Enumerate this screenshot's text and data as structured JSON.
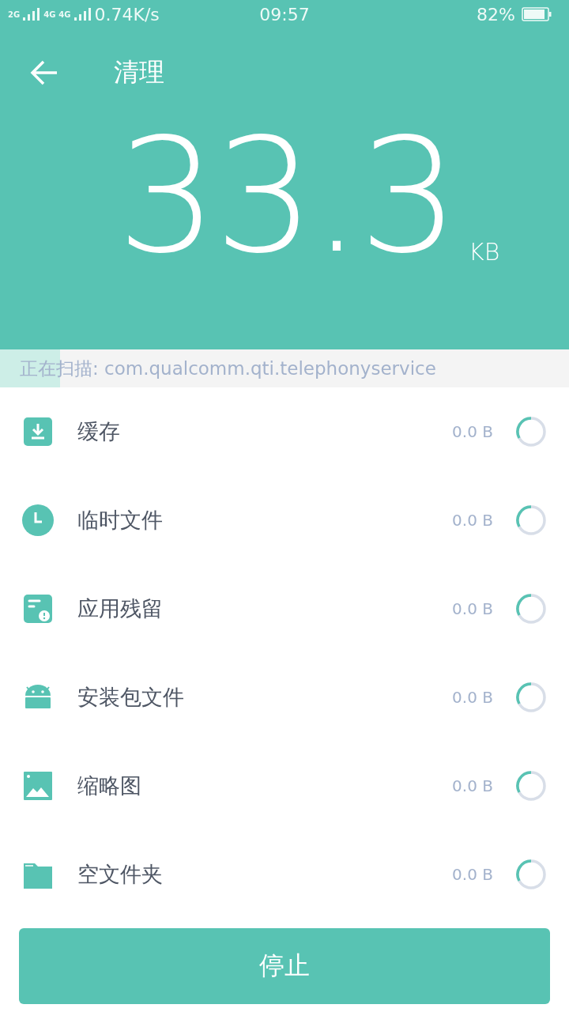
{
  "status_bar": {
    "network_1": "2G",
    "network_2": "4G",
    "network_3": "4G",
    "speed": "0.74K/s",
    "time": "09:57",
    "battery": "82%"
  },
  "header": {
    "title": "清理",
    "size": "33.3",
    "unit": "KB"
  },
  "scan": {
    "text": "正在扫描: com.qualcomm.qti.telephonyservice",
    "level": 0.105
  },
  "items": [
    {
      "kind": "download",
      "label": "缓存",
      "size": "0.0 B"
    },
    {
      "kind": "clock",
      "label": "临时文件",
      "size": "0.0 B"
    },
    {
      "kind": "residue",
      "label": "应用残留",
      "size": "0.0 B"
    },
    {
      "kind": "android",
      "label": "安装包文件",
      "size": "0.0 B"
    },
    {
      "kind": "image",
      "label": "缩略图",
      "size": "0.0 B"
    },
    {
      "kind": "folder",
      "label": "空文件夹",
      "size": "0.0 B"
    }
  ],
  "button": "停止"
}
